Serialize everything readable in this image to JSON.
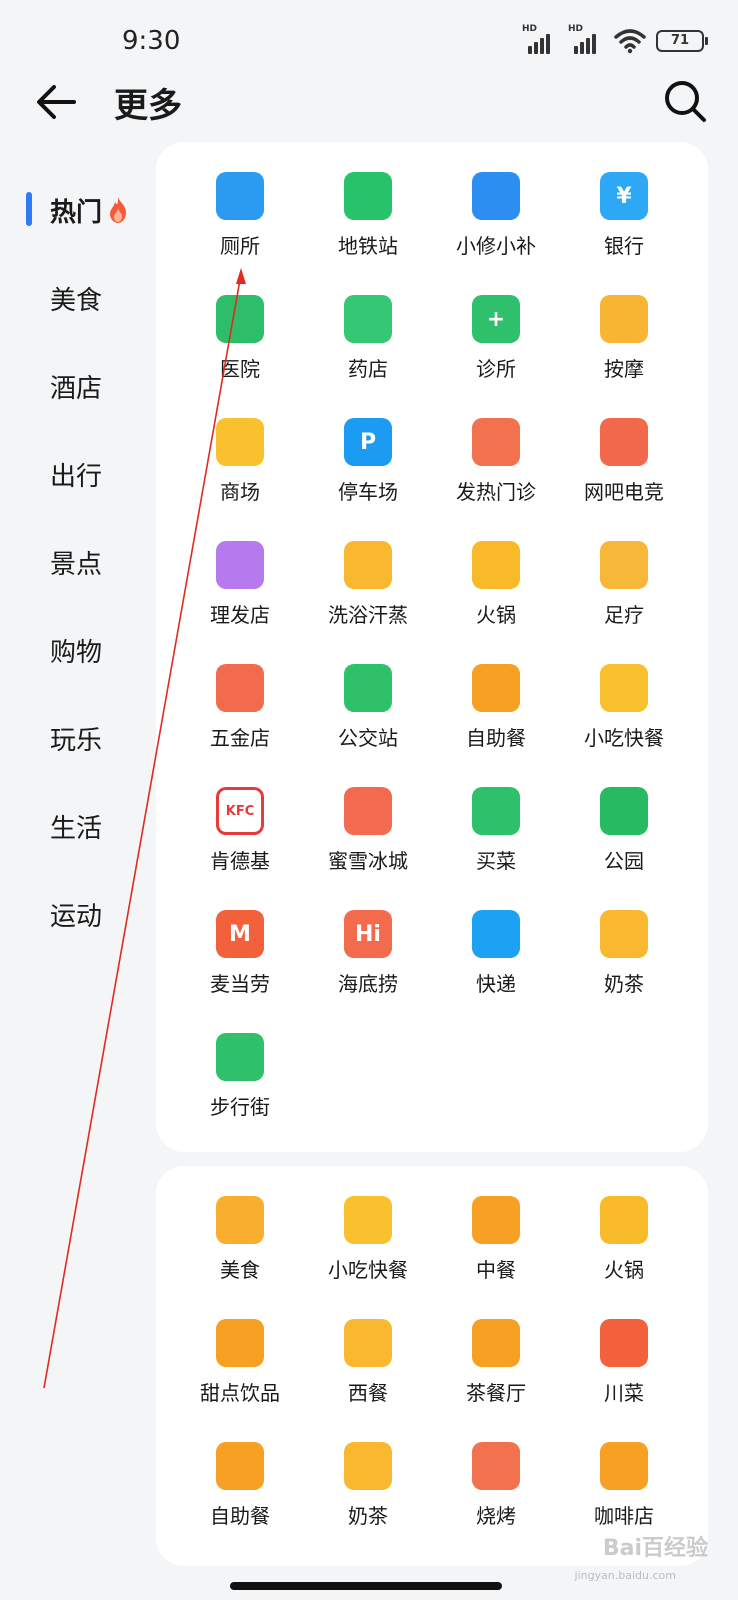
{
  "status_bar": {
    "time": "9:30",
    "battery": "71",
    "hd_label": "HD"
  },
  "header": {
    "title": "更多"
  },
  "sidebar": {
    "items": [
      {
        "label": "热门",
        "active": true
      },
      {
        "label": "美食"
      },
      {
        "label": "酒店"
      },
      {
        "label": "出行"
      },
      {
        "label": "景点"
      },
      {
        "label": "购物"
      },
      {
        "label": "玩乐"
      },
      {
        "label": "生活"
      },
      {
        "label": "运动"
      }
    ]
  },
  "hot_section": {
    "items": [
      {
        "label": "厕所",
        "icon": "restroom-icon",
        "color": "#2a9bf0"
      },
      {
        "label": "地铁站",
        "icon": "subway-icon",
        "color": "#27c36a"
      },
      {
        "label": "小修小补",
        "icon": "wrench-icon",
        "color": "#2d8ef2"
      },
      {
        "label": "银行",
        "icon": "bank-icon",
        "color": "#2da8f5",
        "glyph": "¥"
      },
      {
        "label": "医院",
        "icon": "hospital-icon",
        "color": "#2ebd68"
      },
      {
        "label": "药店",
        "icon": "pill-icon",
        "color": "#35c774"
      },
      {
        "label": "诊所",
        "icon": "clinic-icon",
        "color": "#2fc06c",
        "glyph": "+"
      },
      {
        "label": "按摩",
        "icon": "massage-icon",
        "color": "#f7b533"
      },
      {
        "label": "商场",
        "icon": "mall-icon",
        "color": "#f9c12e"
      },
      {
        "label": "停车场",
        "icon": "parking-icon",
        "color": "#1c9bf2",
        "glyph": "P"
      },
      {
        "label": "发热门诊",
        "icon": "fever-clinic-icon",
        "color": "#f2714f"
      },
      {
        "label": "网吧电竞",
        "icon": "internet-cafe-icon",
        "color": "#f2684a"
      },
      {
        "label": "理发店",
        "icon": "scissors-icon",
        "color": "#b679ee"
      },
      {
        "label": "洗浴汗蒸",
        "icon": "bath-icon",
        "color": "#f9b830"
      },
      {
        "label": "火锅",
        "icon": "hotpot-icon",
        "color": "#f9ba29"
      },
      {
        "label": "足疗",
        "icon": "foot-icon",
        "color": "#f7b839"
      },
      {
        "label": "五金店",
        "icon": "tools-icon",
        "color": "#f26b4c"
      },
      {
        "label": "公交站",
        "icon": "bus-icon",
        "color": "#30c06a"
      },
      {
        "label": "自助餐",
        "icon": "buffet-icon",
        "color": "#f7a023"
      },
      {
        "label": "小吃快餐",
        "icon": "bun-icon",
        "color": "#f9c12e"
      },
      {
        "label": "肯德基",
        "icon": "kfc-icon",
        "color": "#e53b3b",
        "glyph": "KFC"
      },
      {
        "label": "蜜雪冰城",
        "icon": "mixue-icon",
        "color": "#f26b50"
      },
      {
        "label": "买菜",
        "icon": "basket-icon",
        "color": "#2ec06a"
      },
      {
        "label": "公园",
        "icon": "tree-icon",
        "color": "#27ba62"
      },
      {
        "label": "麦当劳",
        "icon": "mcdonalds-icon",
        "color": "#f2603c",
        "glyph": "M"
      },
      {
        "label": "海底捞",
        "icon": "haidilao-icon",
        "color": "#f26b4c",
        "glyph": "Hi"
      },
      {
        "label": "快递",
        "icon": "package-icon",
        "color": "#1ba2f3"
      },
      {
        "label": "奶茶",
        "icon": "milk-tea-icon",
        "color": "#f9b830"
      },
      {
        "label": "步行街",
        "icon": "pedestrian-icon",
        "color": "#2ec06a"
      }
    ]
  },
  "food_section": {
    "items": [
      {
        "label": "美食",
        "icon": "fork-spoon-icon",
        "color": "#f9ad2e"
      },
      {
        "label": "小吃快餐",
        "icon": "bun-icon",
        "color": "#f9c12e"
      },
      {
        "label": "中餐",
        "icon": "bowl-icon",
        "color": "#f7a023"
      },
      {
        "label": "火锅",
        "icon": "hotpot-icon",
        "color": "#f9ba29"
      },
      {
        "label": "甜点饮品",
        "icon": "coffee-cup-icon",
        "color": "#f7a023"
      },
      {
        "label": "西餐",
        "icon": "burger-icon",
        "color": "#f9b830"
      },
      {
        "label": "茶餐厅",
        "icon": "teapot-icon",
        "color": "#f7a023"
      },
      {
        "label": "川菜",
        "icon": "chili-icon",
        "color": "#f2603c"
      },
      {
        "label": "自助餐",
        "icon": "buffet-icon",
        "color": "#f7a023"
      },
      {
        "label": "奶茶",
        "icon": "milk-tea-icon",
        "color": "#f9b830"
      },
      {
        "label": "烧烤",
        "icon": "bbq-icon",
        "color": "#f2714f"
      },
      {
        "label": "咖啡店",
        "icon": "coffee-icon",
        "color": "#f7a023"
      }
    ]
  },
  "watermark": {
    "text": "Bai百经验",
    "sub": "jingyan.baidu.com"
  }
}
